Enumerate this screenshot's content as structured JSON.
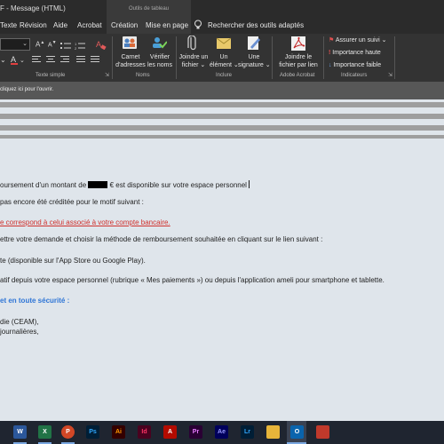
{
  "window": {
    "title": "F - Message (HTML)",
    "tool_tab": "Outils de tableau"
  },
  "menu": {
    "items": [
      "Texte",
      "Révision",
      "Aide",
      "Acrobat",
      "Création",
      "Mise en page"
    ],
    "search": "Rechercher des outils adaptés"
  },
  "ribbon": {
    "groups": {
      "texte_simple": "Texte simple",
      "noms": "Noms",
      "inclure": "Inclure",
      "adobe_acrobat": "Adobe Acrobat",
      "indicateurs": "Indicateurs"
    },
    "buttons": {
      "carnet": [
        "Carnet",
        "d'adresses"
      ],
      "verifier": [
        "Vérifier",
        "les noms"
      ],
      "joindre_fichier": [
        "Joindre un",
        "fichier ⌄"
      ],
      "element": [
        "Un",
        "élément ⌄"
      ],
      "signature": [
        "Une",
        "signature ⌄"
      ],
      "joindre_lien": [
        "Joindre le",
        "fichier par lien"
      ],
      "assurer_suivi": "Assurer un suivi ⌄",
      "importance_haute": "Importance haute",
      "importance_faible": "Importance faible"
    }
  },
  "infobar": {
    "text": "cliquez ici pour l'ouvrir."
  },
  "body": {
    "line1a": "oursement d'un montant de",
    "line1b": "€ est disponible sur votre espace personnel",
    "line2": "pas encore été créditée pour le motif suivant :",
    "line3": "e correspond à celui associé à votre compte bancaire.",
    "line4": "ettre votre demande et choisir la méthode de remboursement souhaitée en cliquant sur le lien suivant :",
    "line5": "te (disponible sur l'App Store ou Google Play).",
    "line6": "atif depuis votre espace personnel (rubrique « Mes paiements ») ou depuis l'application ameli pour smartphone et tablette.",
    "line7": "et en toute sécurité :",
    "line8": "die (CEAM),",
    "line9": "journalières,"
  },
  "taskbar": {
    "apps": [
      "word-icon",
      "excel-icon",
      "powerpoint-icon",
      "photoshop-icon",
      "illustrator-icon",
      "indesign-icon",
      "acrobat-icon",
      "premiere-icon",
      "aftereffects-icon",
      "lightroom-icon",
      "file-explorer-icon",
      "outlook-icon",
      "other-app-icon"
    ],
    "labels": [
      "W",
      "X",
      "P",
      "Ps",
      "Ai",
      "Id",
      "A",
      "Pr",
      "Ae",
      "Lr",
      "",
      "O",
      ""
    ]
  }
}
